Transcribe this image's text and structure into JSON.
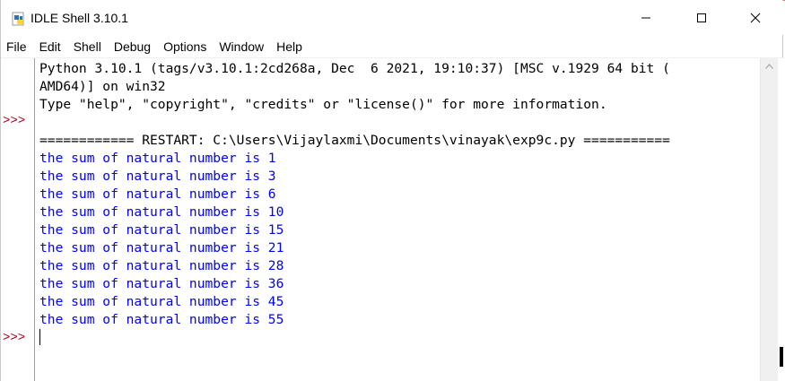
{
  "window": {
    "title": "IDLE Shell 3.10.1",
    "minimize_glyph": "—",
    "maximize_glyph": "☐",
    "close_glyph": "✕"
  },
  "menu": [
    "File",
    "Edit",
    "Shell",
    "Debug",
    "Options",
    "Window",
    "Help"
  ],
  "prompts": [
    ">>>",
    ">>>"
  ],
  "banner": {
    "line1": "Python 3.10.1 (tags/v3.10.1:2cd268a, Dec  6 2021, 19:10:37) [MSC v.1929 64 bit (",
    "line2": "AMD64)] on win32",
    "line3": "Type \"help\", \"copyright\", \"credits\" or \"license()\" for more information."
  },
  "restart_line": "============ RESTART: C:\\Users\\Vijaylaxmi\\Documents\\vinayak\\exp9c.py ===========",
  "output": [
    "the sum of natural number is 1",
    "the sum of natural number is 3",
    "the sum of natural number is 6",
    "the sum of natural number is 10",
    "the sum of natural number is 15",
    "the sum of natural number is 21",
    "the sum of natural number is 28",
    "the sum of natural number is 36",
    "the sum of natural number is 45",
    "the sum of natural number is 55"
  ],
  "colors": {
    "output_text": "#0000ff",
    "prompt": "#a0001d",
    "banner_text": "#000000"
  },
  "icons": {
    "app": "idle-python-icon",
    "scroll_up": "scroll-up-arrow-icon"
  }
}
